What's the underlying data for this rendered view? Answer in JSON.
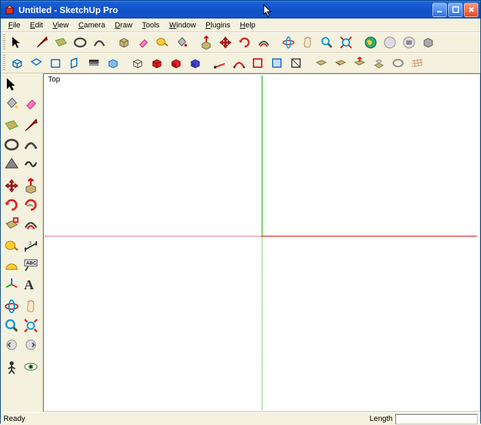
{
  "title": "Untitled - SketchUp Pro",
  "menu": {
    "file": "File",
    "edit": "Edit",
    "view": "View",
    "camera": "Camera",
    "draw": "Draw",
    "tools": "Tools",
    "window": "Window",
    "plugins": "Plugins",
    "help": "Help"
  },
  "viewport": {
    "label": "Top"
  },
  "status": {
    "ready": "Ready",
    "length_label": "Length",
    "length_value": ""
  },
  "window_buttons": {
    "min": "_",
    "max": "□",
    "close": "×"
  }
}
